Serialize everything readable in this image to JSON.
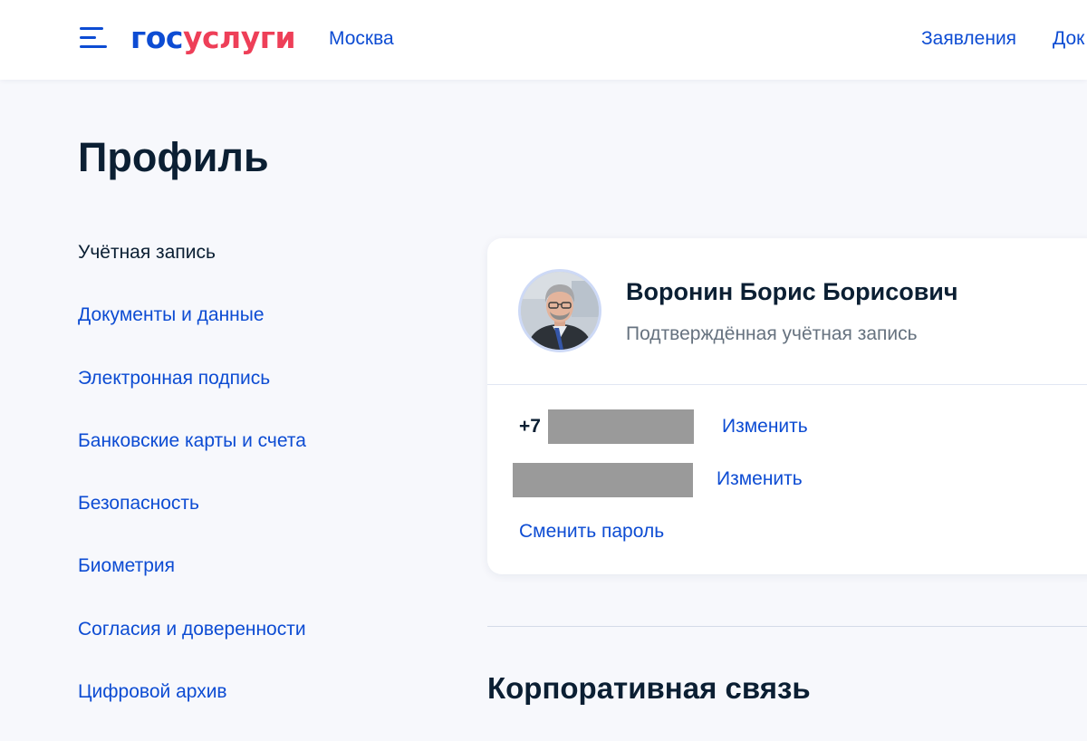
{
  "header": {
    "logo": {
      "part1": "гос",
      "part2": "услуги"
    },
    "region": "Москва",
    "nav": {
      "applications": "Заявления",
      "documents": "Док"
    }
  },
  "page": {
    "title": "Профиль"
  },
  "sidebar": {
    "items": [
      {
        "label": "Учётная запись",
        "active": true
      },
      {
        "label": "Документы и данные"
      },
      {
        "label": "Электронная подпись"
      },
      {
        "label": "Банковские карты и счета"
      },
      {
        "label": "Безопасность"
      },
      {
        "label": "Биометрия"
      },
      {
        "label": "Согласия и доверенности"
      },
      {
        "label": "Цифровой архив"
      }
    ]
  },
  "profile": {
    "name": "Воронин Борис Борисович",
    "status": "Подтверждённая учётная запись",
    "phone_prefix": "+7",
    "phone_change": "Изменить",
    "email_change": "Изменить",
    "change_password": "Сменить пароль"
  },
  "sections": {
    "corporate": "Корпоративная связь"
  },
  "colors": {
    "brand_blue": "#0d4cd3",
    "brand_red": "#ee3f58",
    "text_dark": "#0b1f33",
    "text_secondary": "#66727f",
    "background": "#f7f8fc"
  }
}
